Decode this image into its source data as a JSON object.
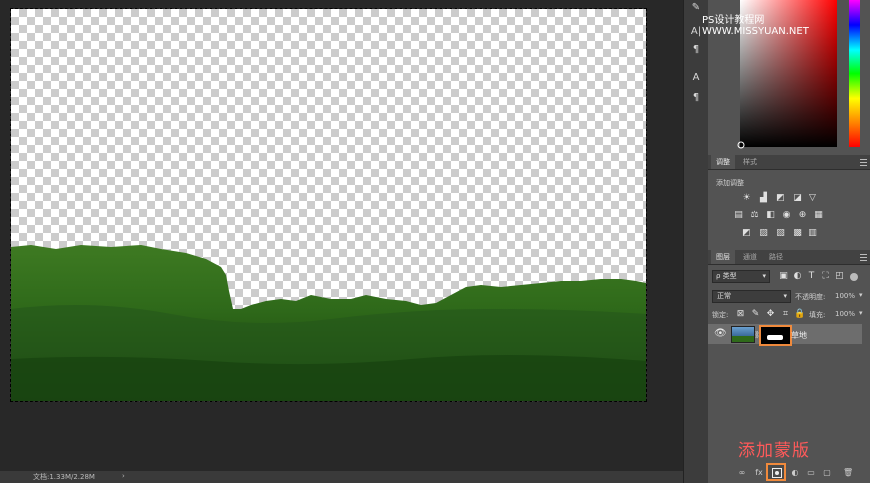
{
  "watermark": "PS设计教程网 WWW.MISSYUAN.NET",
  "status": {
    "doc_size": "文档:1.33M/2.28M",
    "arrow": "›"
  },
  "tools": [
    {
      "icon": "character-panel-icon",
      "glyph": "A|"
    },
    {
      "icon": "paragraph-panel-icon",
      "glyph": "¶"
    },
    {
      "icon": "character-styles-icon",
      "glyph": "A"
    },
    {
      "icon": "paragraph-styles-icon",
      "glyph": "¶"
    }
  ],
  "adjust_panel": {
    "tabs": [
      "调整",
      "样式"
    ],
    "title": "添加调整"
  },
  "layers_panel": {
    "tabs": [
      "图层",
      "通道",
      "路径"
    ],
    "filter_label": "ρ 类型",
    "blend_mode": "正常",
    "opacity_label": "不透明度:",
    "opacity_value": "100%",
    "lock_label": "锁定:",
    "fill_label": "填充:",
    "fill_value": "100%",
    "layer_name": "草地"
  },
  "annotation": "添加蒙版",
  "colors": {
    "accent_highlight": "#f08a3c",
    "annotation": "#ff5a5a",
    "panel_bg": "#535353",
    "workspace_bg": "#282828"
  }
}
